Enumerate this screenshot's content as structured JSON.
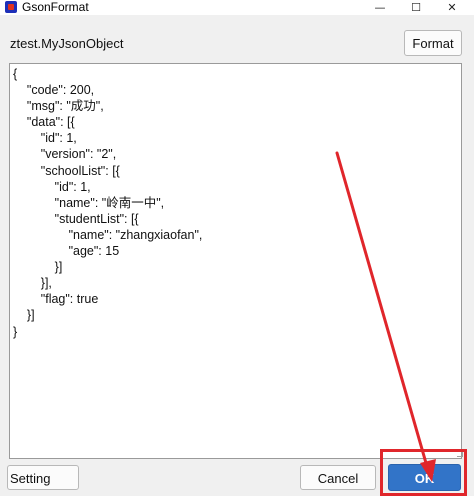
{
  "window": {
    "title": "GsonFormat",
    "minimize_icon": "minimize-icon",
    "maximize_icon": "maximize-icon",
    "close_icon": "close-icon"
  },
  "header": {
    "class_name": "ztest.MyJsonObject",
    "format_label": "Format"
  },
  "editor": {
    "content": "{\n    \"code\": 200,\n    \"msg\": \"成功\",\n    \"data\": [{\n        \"id\": 1,\n        \"version\": \"2\",\n        \"schoolList\": [{\n            \"id\": 1,\n            \"name\": \"岭南一中\",\n            \"studentList\": [{\n                \"name\": \"zhangxiaofan\",\n                \"age\": 15\n            }]\n        }],\n        \"flag\": true\n    }]\n}"
  },
  "footer": {
    "setting_label": "Setting",
    "cancel_label": "Cancel",
    "ok_label": "OK"
  },
  "annotation": {
    "color": "#e0262b"
  },
  "colors": {
    "ok_button": "#3274c8"
  }
}
